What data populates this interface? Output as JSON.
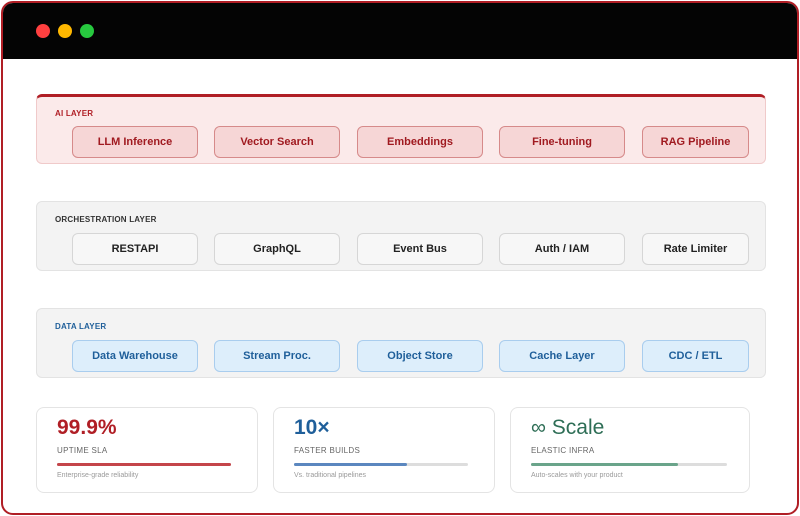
{
  "window": {
    "controls": [
      {
        "name": "close",
        "color": "#ff4040"
      },
      {
        "name": "minimize",
        "color": "#ffb800"
      },
      {
        "name": "maximize",
        "color": "#27c93f"
      }
    ]
  },
  "layers": {
    "ai": {
      "title": "AI LAYER",
      "accent": "#b01e25",
      "items": [
        "LLM Inference",
        "Vector Search",
        "Embeddings",
        "Fine-tuning",
        "RAG Pipeline"
      ]
    },
    "orchestration": {
      "title": "ORCHESTRATION LAYER",
      "items": [
        "RESTAPI",
        "GraphQL",
        "Event Bus",
        "Auth / IAM",
        "Rate Limiter"
      ]
    },
    "data": {
      "title": "DATA LAYER",
      "accent": "#1f5f9a",
      "items": [
        "Data Warehouse",
        "Stream Proc.",
        "Object Store",
        "Cache Layer",
        "CDC / ETL"
      ]
    }
  },
  "stats": [
    {
      "value": "99.9%",
      "label": "UPTIME SLA",
      "description": "Enterprise-grade reliability",
      "progress": 1.0,
      "color": "#b01e25"
    },
    {
      "value": "10×",
      "label": "FASTER BUILDS",
      "description": "Vs. traditional pipelines",
      "progress": 0.65,
      "color": "#1f5f9a"
    },
    {
      "value": "∞ Scale",
      "label": "ELASTIC INFRA",
      "description": "Auto-scales with your product",
      "progress": 0.75,
      "color": "#2e6e56"
    }
  ]
}
